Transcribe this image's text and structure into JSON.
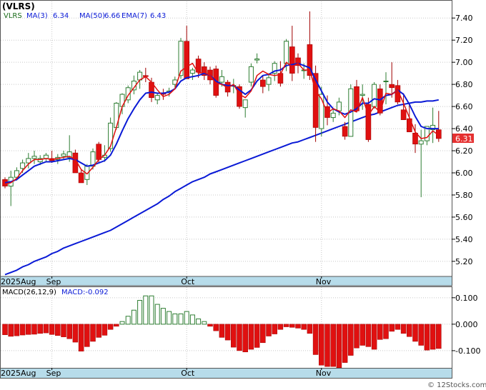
{
  "header": {
    "symbol": "(VLRS)",
    "ticker_legend": "VLRS",
    "ma3_label": "MA(3)",
    "ma3_value": "6.34",
    "ma50_label": "MA(50)",
    "ma50_value": "6.66",
    "ema7_label": "EMA(7)",
    "ema7_value": "6.43"
  },
  "price_tag": "6.31",
  "macd_legend": {
    "label": "MACD(26,12,9)",
    "value_label": "MACD:-0.092"
  },
  "watermark": "© 12Stocks.com",
  "colors": {
    "up": "#2e7d32",
    "down": "#e01010",
    "ma3": "#e01010",
    "ma_blue": "#0a1ad6",
    "axis_band": "#b7dcea",
    "grid": "#c8c8c8",
    "tag_bg": "#e53030"
  },
  "chart_data": [
    {
      "type": "candlestick",
      "title": "(VLRS)",
      "y_ticks": [
        "5.20",
        "5.40",
        "5.60",
        "5.80",
        "6.00",
        "6.20",
        "6.40",
        "6.60",
        "6.80",
        "7.00",
        "7.20",
        "7.40"
      ],
      "ylim": [
        5.07,
        7.55
      ],
      "x_tick_labels": [
        {
          "label": "2025Aug",
          "index": 0
        },
        {
          "label": "Sep",
          "index": 8
        },
        {
          "label": "Oct",
          "index": 31
        },
        {
          "label": "Nov",
          "index": 54
        }
      ],
      "ohlc": [
        [
          5.94,
          5.96,
          5.86,
          5.88
        ],
        [
          5.88,
          6.02,
          5.7,
          5.96
        ],
        [
          5.96,
          6.05,
          5.93,
          6.02
        ],
        [
          6.04,
          6.12,
          6.0,
          6.09
        ],
        [
          6.09,
          6.18,
          6.04,
          6.13
        ],
        [
          6.13,
          6.2,
          6.08,
          6.15
        ],
        [
          6.1,
          6.16,
          6.07,
          6.13
        ],
        [
          6.13,
          6.18,
          6.1,
          6.16
        ],
        [
          6.13,
          6.2,
          6.09,
          6.11
        ],
        [
          6.12,
          6.17,
          6.08,
          6.14
        ],
        [
          6.15,
          6.2,
          6.12,
          6.17
        ],
        [
          6.14,
          6.34,
          6.1,
          6.19
        ],
        [
          6.18,
          6.21,
          6.05,
          6.0
        ],
        [
          6.0,
          6.03,
          5.92,
          5.91
        ],
        [
          5.94,
          6.08,
          5.89,
          6.06
        ],
        [
          6.06,
          6.22,
          6.03,
          6.19
        ],
        [
          6.26,
          6.28,
          6.09,
          6.12
        ],
        [
          6.14,
          6.25,
          6.1,
          6.16
        ],
        [
          6.22,
          6.5,
          6.19,
          6.45
        ],
        [
          6.41,
          6.64,
          6.39,
          6.63
        ],
        [
          6.6,
          6.72,
          6.53,
          6.71
        ],
        [
          6.66,
          6.79,
          6.63,
          6.77
        ],
        [
          6.75,
          6.88,
          6.71,
          6.83
        ],
        [
          6.84,
          6.93,
          6.76,
          6.91
        ],
        [
          6.88,
          6.95,
          6.82,
          6.87
        ],
        [
          6.82,
          6.86,
          6.64,
          6.68
        ],
        [
          6.66,
          6.72,
          6.62,
          6.7
        ],
        [
          6.72,
          6.76,
          6.66,
          6.71
        ],
        [
          6.73,
          6.77,
          6.69,
          6.74
        ],
        [
          6.8,
          6.87,
          6.77,
          6.84
        ],
        [
          6.88,
          7.22,
          6.85,
          7.19
        ],
        [
          7.19,
          7.33,
          6.9,
          6.85
        ],
        [
          6.9,
          6.95,
          6.84,
          6.93
        ],
        [
          7.03,
          7.06,
          6.86,
          6.91
        ],
        [
          6.96,
          7.0,
          6.84,
          6.88
        ],
        [
          6.93,
          6.96,
          6.8,
          6.84
        ],
        [
          6.94,
          6.97,
          6.68,
          6.7
        ],
        [
          6.82,
          6.93,
          6.78,
          6.87
        ],
        [
          6.82,
          6.84,
          6.69,
          6.73
        ],
        [
          6.79,
          6.85,
          6.72,
          6.79
        ],
        [
          6.78,
          6.8,
          6.58,
          6.6
        ],
        [
          6.59,
          6.63,
          6.5,
          6.66
        ],
        [
          6.82,
          6.99,
          6.78,
          6.96
        ],
        [
          7.02,
          7.08,
          6.99,
          7.03
        ],
        [
          6.84,
          6.88,
          6.72,
          6.78
        ],
        [
          6.8,
          6.9,
          6.74,
          6.86
        ],
        [
          6.9,
          7.01,
          6.83,
          6.99
        ],
        [
          6.9,
          7.01,
          6.78,
          6.81
        ],
        [
          6.99,
          7.21,
          6.92,
          7.19
        ],
        [
          7.14,
          7.33,
          6.83,
          6.9
        ],
        [
          7.04,
          7.08,
          6.9,
          6.97
        ],
        [
          6.93,
          6.99,
          6.85,
          6.93
        ],
        [
          7.16,
          7.46,
          6.84,
          6.88
        ],
        [
          6.9,
          6.97,
          6.28,
          6.41
        ],
        [
          6.4,
          6.78,
          6.33,
          6.71
        ],
        [
          6.6,
          6.7,
          6.43,
          6.5
        ],
        [
          6.5,
          6.58,
          6.46,
          6.54
        ],
        [
          6.56,
          6.68,
          6.52,
          6.64
        ],
        [
          6.42,
          6.46,
          6.3,
          6.33
        ],
        [
          6.33,
          6.8,
          6.33,
          6.76
        ],
        [
          6.78,
          6.84,
          6.55,
          6.56
        ],
        [
          6.7,
          6.8,
          6.57,
          6.71
        ],
        [
          6.62,
          6.68,
          6.28,
          6.3
        ],
        [
          6.6,
          6.82,
          6.58,
          6.8
        ],
        [
          6.76,
          6.8,
          6.52,
          6.54
        ],
        [
          6.83,
          6.91,
          6.62,
          6.83
        ],
        [
          6.8,
          7.0,
          6.68,
          6.77
        ],
        [
          6.79,
          6.84,
          6.62,
          6.64
        ],
        [
          6.57,
          6.72,
          6.49,
          6.48
        ],
        [
          6.49,
          6.62,
          6.37,
          6.37
        ],
        [
          6.36,
          6.44,
          6.18,
          6.26
        ],
        [
          6.26,
          6.39,
          5.78,
          6.29
        ],
        [
          6.29,
          6.42,
          6.25,
          6.42
        ],
        [
          6.39,
          6.59,
          6.27,
          6.43
        ],
        [
          6.39,
          6.56,
          6.28,
          6.31
        ]
      ],
      "series": [
        {
          "name": "MA(3)",
          "values": [
            5.9,
            5.91,
            5.95,
            6.02,
            6.08,
            6.12,
            6.12,
            6.13,
            6.12,
            6.13,
            6.14,
            6.15,
            6.12,
            6.03,
            5.99,
            6.05,
            6.12,
            6.16,
            6.24,
            6.41,
            6.6,
            6.7,
            6.77,
            6.84,
            6.87,
            6.82,
            6.75,
            6.69,
            6.71,
            6.76,
            6.92,
            6.96,
            6.99,
            6.9,
            6.91,
            6.88,
            6.81,
            6.8,
            6.77,
            6.8,
            6.71,
            6.68,
            6.74,
            6.88,
            6.92,
            6.89,
            6.88,
            6.89,
            7.0,
            6.96,
            6.99,
            6.93,
            6.93,
            6.74,
            6.67,
            6.54,
            6.58,
            6.56,
            6.5,
            6.57,
            6.55,
            6.68,
            6.52,
            6.6,
            6.55,
            6.72,
            6.71,
            6.75,
            6.63,
            6.5,
            6.37,
            6.31,
            6.32,
            6.38,
            6.34
          ]
        },
        {
          "name": "EMA(7)",
          "values": [
            5.93,
            5.94,
            5.96,
            6.0,
            6.04,
            6.07,
            6.09,
            6.1,
            6.1,
            6.11,
            6.13,
            6.13,
            6.1,
            6.05,
            6.05,
            6.09,
            6.1,
            6.11,
            6.2,
            6.31,
            6.42,
            6.51,
            6.59,
            6.67,
            6.72,
            6.71,
            6.71,
            6.71,
            6.72,
            6.75,
            6.85,
            6.85,
            6.87,
            6.88,
            6.88,
            6.87,
            6.83,
            6.84,
            6.81,
            6.8,
            6.75,
            6.73,
            6.79,
            6.85,
            6.83,
            6.84,
            6.88,
            6.86,
            6.94,
            6.93,
            6.94,
            6.94,
            6.92,
            6.79,
            6.77,
            6.7,
            6.66,
            6.65,
            6.57,
            6.61,
            6.6,
            6.63,
            6.54,
            6.61,
            6.59,
            6.65,
            6.68,
            6.67,
            6.62,
            6.55,
            6.48,
            6.43,
            6.43,
            6.43,
            6.43
          ]
        },
        {
          "name": "EMA-blue",
          "values": [
            5.91,
            5.92,
            5.94,
            5.98,
            6.02,
            6.06,
            6.08,
            6.1,
            6.1,
            6.11,
            6.12,
            6.13,
            6.12,
            6.09,
            6.06,
            6.07,
            6.09,
            6.11,
            6.16,
            6.26,
            6.38,
            6.49,
            6.58,
            6.66,
            6.72,
            6.73,
            6.72,
            6.72,
            6.73,
            6.76,
            6.83,
            6.86,
            6.87,
            6.88,
            6.9,
            6.88,
            6.83,
            6.8,
            6.79,
            6.79,
            6.75,
            6.71,
            6.75,
            6.83,
            6.88,
            6.89,
            6.92,
            6.93,
            6.97,
            6.98,
            6.99,
            6.97,
            6.95,
            6.84,
            6.74,
            6.64,
            6.58,
            6.55,
            6.53,
            6.55,
            6.58,
            6.63,
            6.63,
            6.67,
            6.66,
            6.7,
            6.71,
            6.75,
            6.71,
            6.62,
            6.51,
            6.42,
            6.4,
            6.4,
            6.4
          ]
        },
        {
          "name": "MA(50)",
          "values": [
            5.08,
            5.1,
            5.12,
            5.15,
            5.17,
            5.2,
            5.22,
            5.24,
            5.27,
            5.29,
            5.32,
            5.34,
            5.36,
            5.38,
            5.4,
            5.42,
            5.44,
            5.46,
            5.48,
            5.51,
            5.54,
            5.57,
            5.6,
            5.63,
            5.66,
            5.69,
            5.72,
            5.76,
            5.79,
            5.83,
            5.86,
            5.89,
            5.92,
            5.94,
            5.96,
            5.99,
            6.01,
            6.03,
            6.05,
            6.07,
            6.09,
            6.11,
            6.13,
            6.15,
            6.17,
            6.19,
            6.21,
            6.23,
            6.25,
            6.27,
            6.28,
            6.3,
            6.32,
            6.34,
            6.36,
            6.38,
            6.4,
            6.42,
            6.44,
            6.46,
            6.48,
            6.5,
            6.52,
            6.53,
            6.55,
            6.57,
            6.59,
            6.61,
            6.62,
            6.63,
            6.64,
            6.64,
            6.65,
            6.65,
            6.66
          ]
        }
      ]
    },
    {
      "type": "bar",
      "title": "MACD(26,12,9)",
      "y_ticks": [
        "0.100",
        "0.000",
        "-0.100"
      ],
      "ylim": [
        -0.165,
        0.14
      ],
      "x_tick_labels": [
        {
          "label": "2025Aug",
          "index": 0
        },
        {
          "label": "Sep",
          "index": 8
        },
        {
          "label": "Oct",
          "index": 31
        },
        {
          "label": "Nov",
          "index": 54
        }
      ],
      "values": [
        -0.04,
        -0.046,
        -0.044,
        -0.041,
        -0.039,
        -0.038,
        -0.035,
        -0.033,
        -0.039,
        -0.043,
        -0.048,
        -0.055,
        -0.068,
        -0.102,
        -0.085,
        -0.065,
        -0.05,
        -0.042,
        -0.02,
        -0.008,
        0.01,
        0.03,
        0.053,
        0.09,
        0.107,
        0.107,
        0.075,
        0.06,
        0.048,
        0.039,
        0.039,
        0.048,
        0.035,
        0.02,
        0.01,
        -0.008,
        -0.025,
        -0.05,
        -0.06,
        -0.087,
        -0.1,
        -0.105,
        -0.095,
        -0.088,
        -0.07,
        -0.045,
        -0.037,
        -0.02,
        -0.01,
        -0.012,
        -0.015,
        -0.02,
        -0.035,
        -0.115,
        -0.155,
        -0.16,
        -0.16,
        -0.165,
        -0.145,
        -0.118,
        -0.09,
        -0.08,
        -0.085,
        -0.095,
        -0.058,
        -0.055,
        -0.027,
        -0.02,
        -0.035,
        -0.047,
        -0.065,
        -0.08,
        -0.098,
        -0.095,
        -0.092
      ]
    }
  ]
}
